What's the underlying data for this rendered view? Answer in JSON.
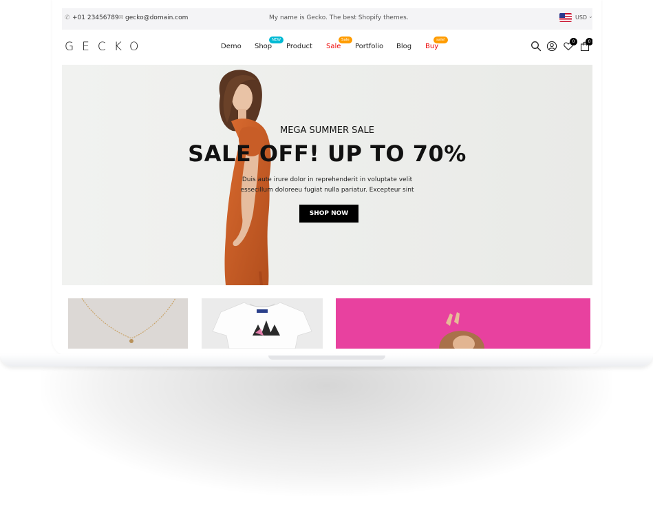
{
  "topbar": {
    "phone": "+01 23456789",
    "email": "gecko@domain.com",
    "message": "My name is Gecko. The best Shopify themes.",
    "currency": "USD",
    "currency_caret": "⌄"
  },
  "header": {
    "logo": "GECKO",
    "nav": {
      "demo": "Demo",
      "shop": "Shop",
      "product": "Product",
      "sale": "Sale",
      "portfolio": "Portfolio",
      "blog": "Blog",
      "buy": "Buy"
    },
    "badges": {
      "shop": "NEW",
      "sale": "Sale",
      "buy": "sale!"
    },
    "wishlist_count": "0",
    "cart_count": "0"
  },
  "hero": {
    "subtitle": "MEGA SUMMER SALE",
    "title": "SALE OFF! UP TO 70%",
    "description": "Duis aute irure dolor in reprehenderit in voluptate velit essecillum doloreeu fugiat nulla pariatur. Excepteur sint",
    "button": "SHOP NOW"
  },
  "colors": {
    "accent_red": "#ec0101",
    "badge_new": "#01bad4",
    "badge_sale": "#ff9c00",
    "tile_pink": "#e8409f"
  }
}
